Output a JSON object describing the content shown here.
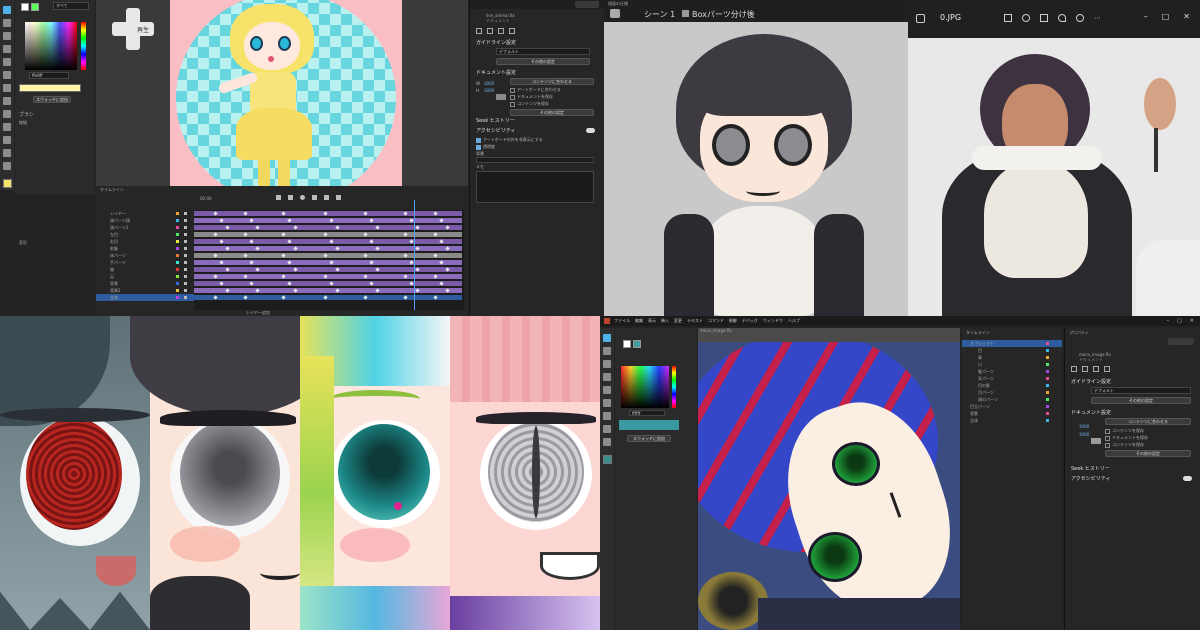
{
  "collage": {
    "panels": [
      "editor-top-left",
      "viewer-top-right",
      "eye-strips-bottom-left",
      "editor-bottom-right"
    ]
  },
  "top_left": {
    "preview_button_label": "再生",
    "toolbar_dropdown": "すべて",
    "color_value": "ffe8ff",
    "swatch_button": "スウォッチに追加",
    "file_title": "live_animal.ltx",
    "file_subtitle": "ドキュメント",
    "section_guide": "ガイドライン設定",
    "guide_select": "デフォルト",
    "guide_button": "その他の設定",
    "section_document": "ドキュメント設定",
    "doc_button": "コンテンツに合わせる",
    "doc_w_label": "W",
    "doc_w_value": "3000",
    "doc_h_label": "H",
    "doc_h_value": "3000",
    "doc_opt1": "アートボードに合わせる",
    "doc_opt2": "ドキュメントを保存",
    "doc_opt3": "コンテンツを保存",
    "doc_button2": "その他の設定",
    "section_history": "Seek ヒストリー",
    "section_access": "アクセシビリティ",
    "access_opt1": "アートボードの外を非表示にする",
    "access_opt2": "透明度",
    "access_label": "背景",
    "memo_label": "メモ",
    "timeline_title": "タイムライン",
    "timecode": "00:00",
    "layer_panel_title": "レイヤー",
    "layer_footer": "レイヤー追加",
    "left_panel_title": "ブラシ",
    "left_section_a": "線幅",
    "left_section_b": "変形",
    "layers": [
      "レイヤー",
      "顔パーツ顔",
      "顔パーツ2",
      "左目",
      "右目",
      "前髪",
      "体パーツ",
      "手パーツ",
      "服",
      "足",
      "背景",
      "背景2",
      "全体"
    ]
  },
  "top_right": {
    "left_window_tab": "描画の仕様",
    "breadcrumb_scene": "シーン 1",
    "breadcrumb_layer": "Boxパーツ分け後",
    "right_window_title": "0.JPG",
    "timeline_label": "タイムライン"
  },
  "bottom_right": {
    "menu_items": [
      "ファイル",
      "編集",
      "表示",
      "挿入",
      "変更",
      "テキスト",
      "コマンド",
      "制御",
      "デバッグ",
      "ウィンドウ",
      "ヘルプ"
    ],
    "doc_tab": "moco_image.fla",
    "layer_panel_title": "タイムライン",
    "props_title": "プロパティ",
    "props_file": "moco_image.fla",
    "props_file_sub": "ドキュメント",
    "section_guide": "ガイドライン設定",
    "guide_select": "デフォルト",
    "guide_button": "その他の設定",
    "section_document": "ドキュメント設定",
    "doc_button": "コンテンツに合わせる",
    "doc_w_value": "3000",
    "doc_h_value": "3000",
    "doc_opt1": "コンテンツを保存",
    "doc_opt2": "ドキュメントを保存",
    "doc_opt3": "コンテンツを保存",
    "doc_button2": "その他の設定",
    "section_history": "Seek ヒストリー",
    "section_access": "アクセシビリティ",
    "color_button": "スウォッチに追加",
    "color_value": "ffffff",
    "layers": [
      "オブジェクト",
      "目",
      "鼻",
      "口",
      "髪パーツ",
      "耳パーツ",
      "目の影",
      "目パーツ",
      "顔のパーツ",
      "目玉パーツ",
      "背景",
      "全体"
    ]
  },
  "colors": {
    "accent": "#4fb0e8",
    "timeline_purple": "#7b5aa8",
    "bg_dark": "#232323"
  }
}
